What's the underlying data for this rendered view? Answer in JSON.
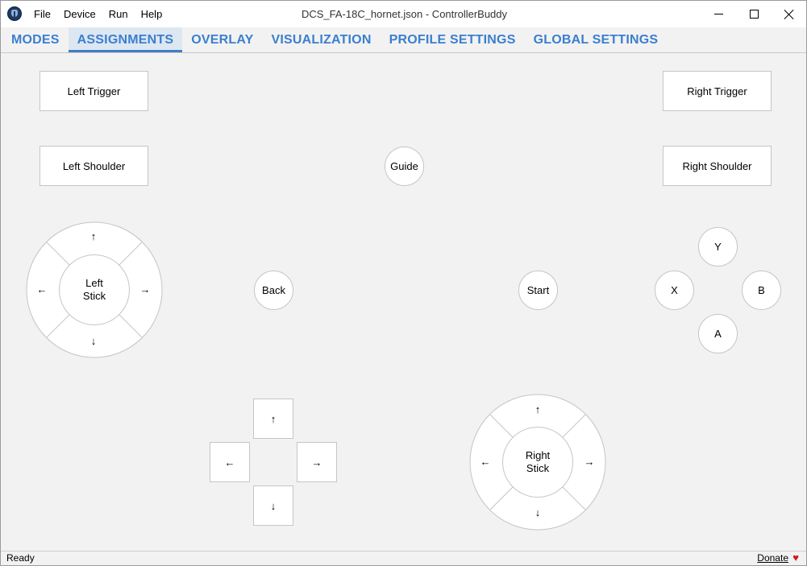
{
  "window": {
    "title": "DCS_FA-18C_hornet.json - ControllerBuddy"
  },
  "menu": {
    "items": [
      "File",
      "Device",
      "Run",
      "Help"
    ]
  },
  "tabs": {
    "items": [
      "MODES",
      "ASSIGNMENTS",
      "OVERLAY",
      "VISUALIZATION",
      "PROFILE SETTINGS",
      "GLOBAL SETTINGS"
    ],
    "active": "ASSIGNMENTS"
  },
  "controls": {
    "left_trigger": "Left Trigger",
    "right_trigger": "Right Trigger",
    "left_shoulder": "Left Shoulder",
    "right_shoulder": "Right Shoulder",
    "guide": "Guide",
    "back": "Back",
    "start": "Start",
    "face_y": "Y",
    "face_x": "X",
    "face_b": "B",
    "face_a": "A"
  },
  "left_stick": {
    "label": "Left\nStick",
    "up": "↑",
    "down": "↓",
    "left": "←",
    "right": "→"
  },
  "right_stick": {
    "label": "Right\nStick",
    "up": "↑",
    "down": "↓",
    "left": "←",
    "right": "→"
  },
  "dpad": {
    "up": "↑",
    "down": "↓",
    "left": "←",
    "right": "→"
  },
  "status": {
    "text": "Ready",
    "donate": "Donate",
    "heart": "♥",
    "heart_color": "#d01818"
  },
  "colors": {
    "accent": "#3a7fcf",
    "active_tab_bg": "#dde7f2",
    "background": "#f2f2f2"
  }
}
